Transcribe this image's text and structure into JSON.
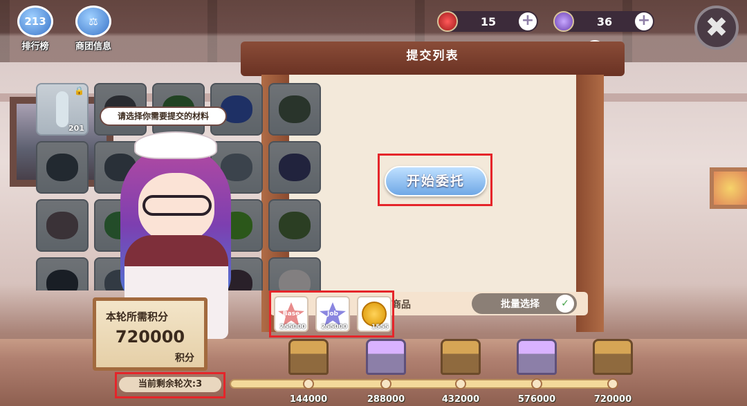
{
  "top_left": {
    "ranking": {
      "label": "排行榜",
      "icon": "ranking-podium-icon",
      "glyph": "213"
    },
    "guild_info": {
      "label": "商团信息",
      "icon": "scales-icon",
      "glyph": "⚖"
    }
  },
  "currency": {
    "hearts": {
      "value": "15",
      "icon": "heart-potion-icon"
    },
    "gems": {
      "value": "36",
      "icon": "purple-cube-icon"
    },
    "plus_glyph": "+"
  },
  "close_glyph": "✖",
  "help_glyph": "?",
  "panel": {
    "title": "提交列表"
  },
  "speech_bubble": "请选择你需要提交的材料",
  "materials": {
    "first_item_count": "201",
    "lock_glyph": "🔒",
    "colors": [
      "#d9e4ea",
      "#4a4f58",
      "#3c7a3f",
      "#3757b8",
      "#4b5f4e",
      "#3d4a58",
      "#4a5866",
      "#56627a",
      "#6c7a8a",
      "#3c3f6f",
      "#6a5a64",
      "#3f8a4a",
      "#2f66b0",
      "#4f9f2f",
      "#4f7040",
      "#2e3744",
      "#5a6a7a",
      "#7a8898",
      "#4a3a4a",
      "#ece6e8"
    ]
  },
  "start_button": "开始委托",
  "goods_label": "商品",
  "batch_select": {
    "label": "批量选择",
    "check_glyph": "✓"
  },
  "rewards": [
    {
      "label": "Base",
      "count": "255000",
      "color": "#e88b8b"
    },
    {
      "label": "Job",
      "count": "255000",
      "color": "#8a86e0"
    },
    {
      "label": "",
      "count": "1555",
      "color": "#f0b000"
    }
  ],
  "points_board": {
    "title": "本轮所需积分",
    "value": "720000",
    "unit": "积分"
  },
  "remaining_rounds": "当前剩余轮次:3",
  "milestones": [
    "144000",
    "288000",
    "432000",
    "576000",
    "720000"
  ],
  "accent_red": "#e5252a"
}
